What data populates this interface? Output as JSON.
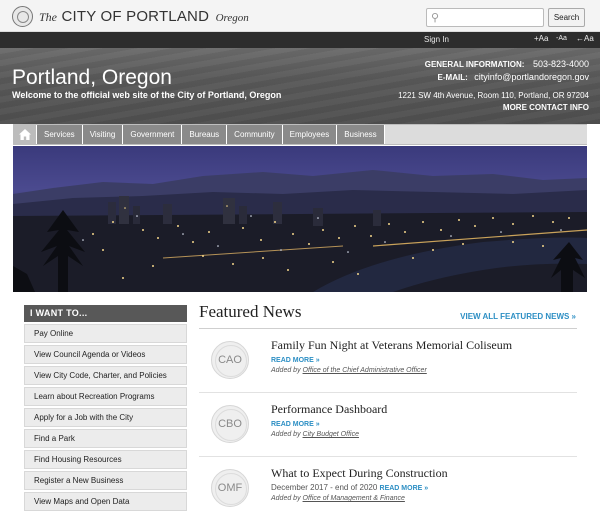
{
  "topbar": {
    "logo_the": "The",
    "logo_city": "CITY OF PORTLAND",
    "logo_state": "Oregon",
    "search_placeholder": "",
    "search_value": "",
    "search_button": "Search"
  },
  "utility": {
    "sign_in": "Sign In",
    "font_increase": "+Aa",
    "font_decrease": "-Aa",
    "font_reset": "Aa"
  },
  "header": {
    "title": "Portland, Oregon",
    "subtitle": "Welcome to the official web site of the City of Portland, Oregon",
    "general_label": "GENERAL INFORMATION:",
    "general_phone": "503-823-4000",
    "email_label": "E-MAIL:",
    "email_value": "cityinfo@portlandoregon.gov",
    "address": "1221 SW 4th Avenue, Room 110, Portland, OR 97204",
    "more_contact": "MORE CONTACT INFO"
  },
  "nav": {
    "items": [
      "Services",
      "Visiting",
      "Government",
      "Bureaus",
      "Community",
      "Employees",
      "Business"
    ]
  },
  "sidebar": {
    "heading": "I WANT TO...",
    "items": [
      "Pay Online",
      "View Council Agenda or Videos",
      "View City Code, Charter, and Policies",
      "Learn about Recreation Programs",
      "Apply for a Job with the City",
      "Find a Park",
      "Find Housing Resources",
      "Register a New Business",
      "View Maps and Open Data"
    ]
  },
  "news": {
    "heading": "Featured News",
    "view_all": "VIEW ALL FEATURED NEWS »",
    "items": [
      {
        "badge": "CAO",
        "title": "Family Fun Night at Veterans Memorial Coliseum",
        "date": "",
        "read_more": "READ MORE »",
        "added_by": "Added by",
        "org": "Office of the Chief Administrative Officer"
      },
      {
        "badge": "CBO",
        "title": "Performance Dashboard",
        "date": "",
        "read_more": "READ MORE »",
        "added_by": "Added by",
        "org": "City Budget Office"
      },
      {
        "badge": "OMF",
        "title": "What to Expect During Construction",
        "date": "December 2017 - end of 2020",
        "read_more": "READ MORE »",
        "added_by": "Added by",
        "org": "Office of Management & Finance"
      }
    ]
  },
  "colors": {
    "link": "#2d8fc4",
    "header_bg": "#595959",
    "nav_item_bg": "#8a8a8a",
    "sidebar_head_bg": "#585858"
  }
}
